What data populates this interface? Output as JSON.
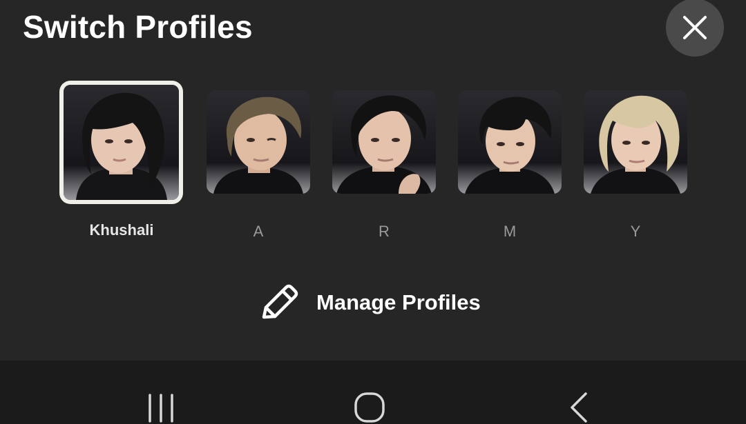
{
  "header": {
    "title": "Switch Profiles",
    "close_icon": "close-icon"
  },
  "profiles": [
    {
      "name": "Khushali",
      "selected": true,
      "avatar_icon": "profile-avatar"
    },
    {
      "name": "A",
      "selected": false,
      "avatar_icon": "profile-avatar"
    },
    {
      "name": "R",
      "selected": false,
      "avatar_icon": "profile-avatar"
    },
    {
      "name": "M",
      "selected": false,
      "avatar_icon": "profile-avatar"
    },
    {
      "name": "Y",
      "selected": false,
      "avatar_icon": "profile-avatar"
    }
  ],
  "manage": {
    "label": "Manage Profiles",
    "icon": "pencil-icon"
  },
  "system_nav": {
    "recents_icon": "recents-icon",
    "home_icon": "home-icon",
    "back_icon": "back-icon"
  },
  "colors": {
    "background": "#262626",
    "nav_background": "#1b1b1b",
    "selected_border": "#f1efe9",
    "inactive_text": "#9a9a9a"
  }
}
